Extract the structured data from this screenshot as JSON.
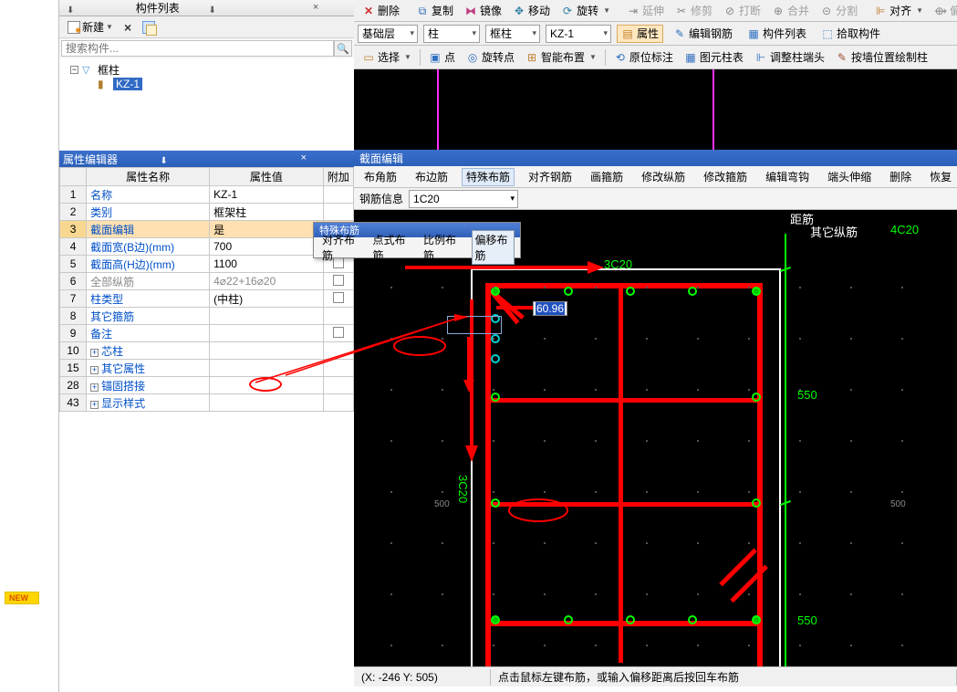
{
  "leftPanel": {
    "title": "构件列表",
    "newLabel": "新建",
    "searchPlaceholder": "搜索构件...",
    "tree": {
      "root": "框柱",
      "child": "KZ-1"
    }
  },
  "propPanel": {
    "title": "属性编辑器",
    "headers": {
      "name": "属性名称",
      "value": "属性值",
      "extra": "附加"
    },
    "rows": [
      {
        "n": "1",
        "name": "名称",
        "val": "KZ-1"
      },
      {
        "n": "2",
        "name": "类别",
        "val": "框架柱"
      },
      {
        "n": "3",
        "name": "截面编辑",
        "val": "是",
        "chk": true,
        "sel": true
      },
      {
        "n": "4",
        "name": "截面宽(B边)(mm)",
        "val": "700",
        "chk": true
      },
      {
        "n": "5",
        "name": "截面高(H边)(mm)",
        "val": "1100",
        "chk": true
      },
      {
        "n": "6",
        "name": "全部纵筋",
        "val": "4⌀22+16⌀20",
        "chk": true,
        "gray": true
      },
      {
        "n": "7",
        "name": "柱类型",
        "val": "(中柱)",
        "chk": true
      },
      {
        "n": "8",
        "name": "其它箍筋",
        "val": ""
      },
      {
        "n": "9",
        "name": "备注",
        "val": "",
        "chk": true
      },
      {
        "n": "10",
        "name": "芯柱",
        "val": "",
        "exp": true
      },
      {
        "n": "15",
        "name": "其它属性",
        "val": "",
        "exp": true
      },
      {
        "n": "28",
        "name": "锚固搭接",
        "val": "",
        "exp": true
      },
      {
        "n": "43",
        "name": "显示样式",
        "val": "",
        "exp": true
      }
    ]
  },
  "topToolbar": {
    "btns": [
      "删除",
      "复制",
      "镜像",
      "移动",
      "旋转"
    ],
    "disabled": [
      "延伸",
      "修剪",
      "打断",
      "合并",
      "分割"
    ],
    "align": "对齐",
    "offset": "偏移"
  },
  "comboRow": {
    "c1": "基础层",
    "c2": "柱",
    "c3": "框柱",
    "c4": "KZ-1",
    "btns": [
      "属性",
      "编辑钢筋",
      "构件列表",
      "拾取构件"
    ]
  },
  "toolbar2": {
    "sel": "选择",
    "pt": "点",
    "rpt": "旋转点",
    "smart": "智能布置",
    "orig": "原位标注",
    "coltbl": "图元柱表",
    "adj": "调整柱端头",
    "wall": "按墙位置绘制柱"
  },
  "section": {
    "title": "截面编辑",
    "tabs": [
      "布角筋",
      "布边筋",
      "特殊布筋",
      "对齐钢筋",
      "画箍筋",
      "修改纵筋",
      "修改箍筋",
      "编辑弯钩",
      "端头伸缩",
      "删除",
      "恢复"
    ],
    "activeTab": 2,
    "rebarLabel": "钢筋信息",
    "rebarVal": "1C20"
  },
  "popup": {
    "title": "特殊布筋",
    "items": [
      "对齐布筋",
      "点式布筋",
      "比例布筋",
      "偏移布筋"
    ],
    "active": 3
  },
  "cad": {
    "topLabel": "3C20",
    "rightLabelA": "其它纵筋",
    "rightLabelB": "4C20",
    "rightTop": "距筋",
    "sideLabel": "3C20",
    "dim550a": "550",
    "dim550b": "550",
    "inputVal": "60.96",
    "tick500": "500"
  },
  "status": {
    "coord": "(X: -246 Y: 505)",
    "hint": "点击鼠标左键布筋，或输入偏移距离后按回车布筋"
  },
  "newBadge": "NEW"
}
